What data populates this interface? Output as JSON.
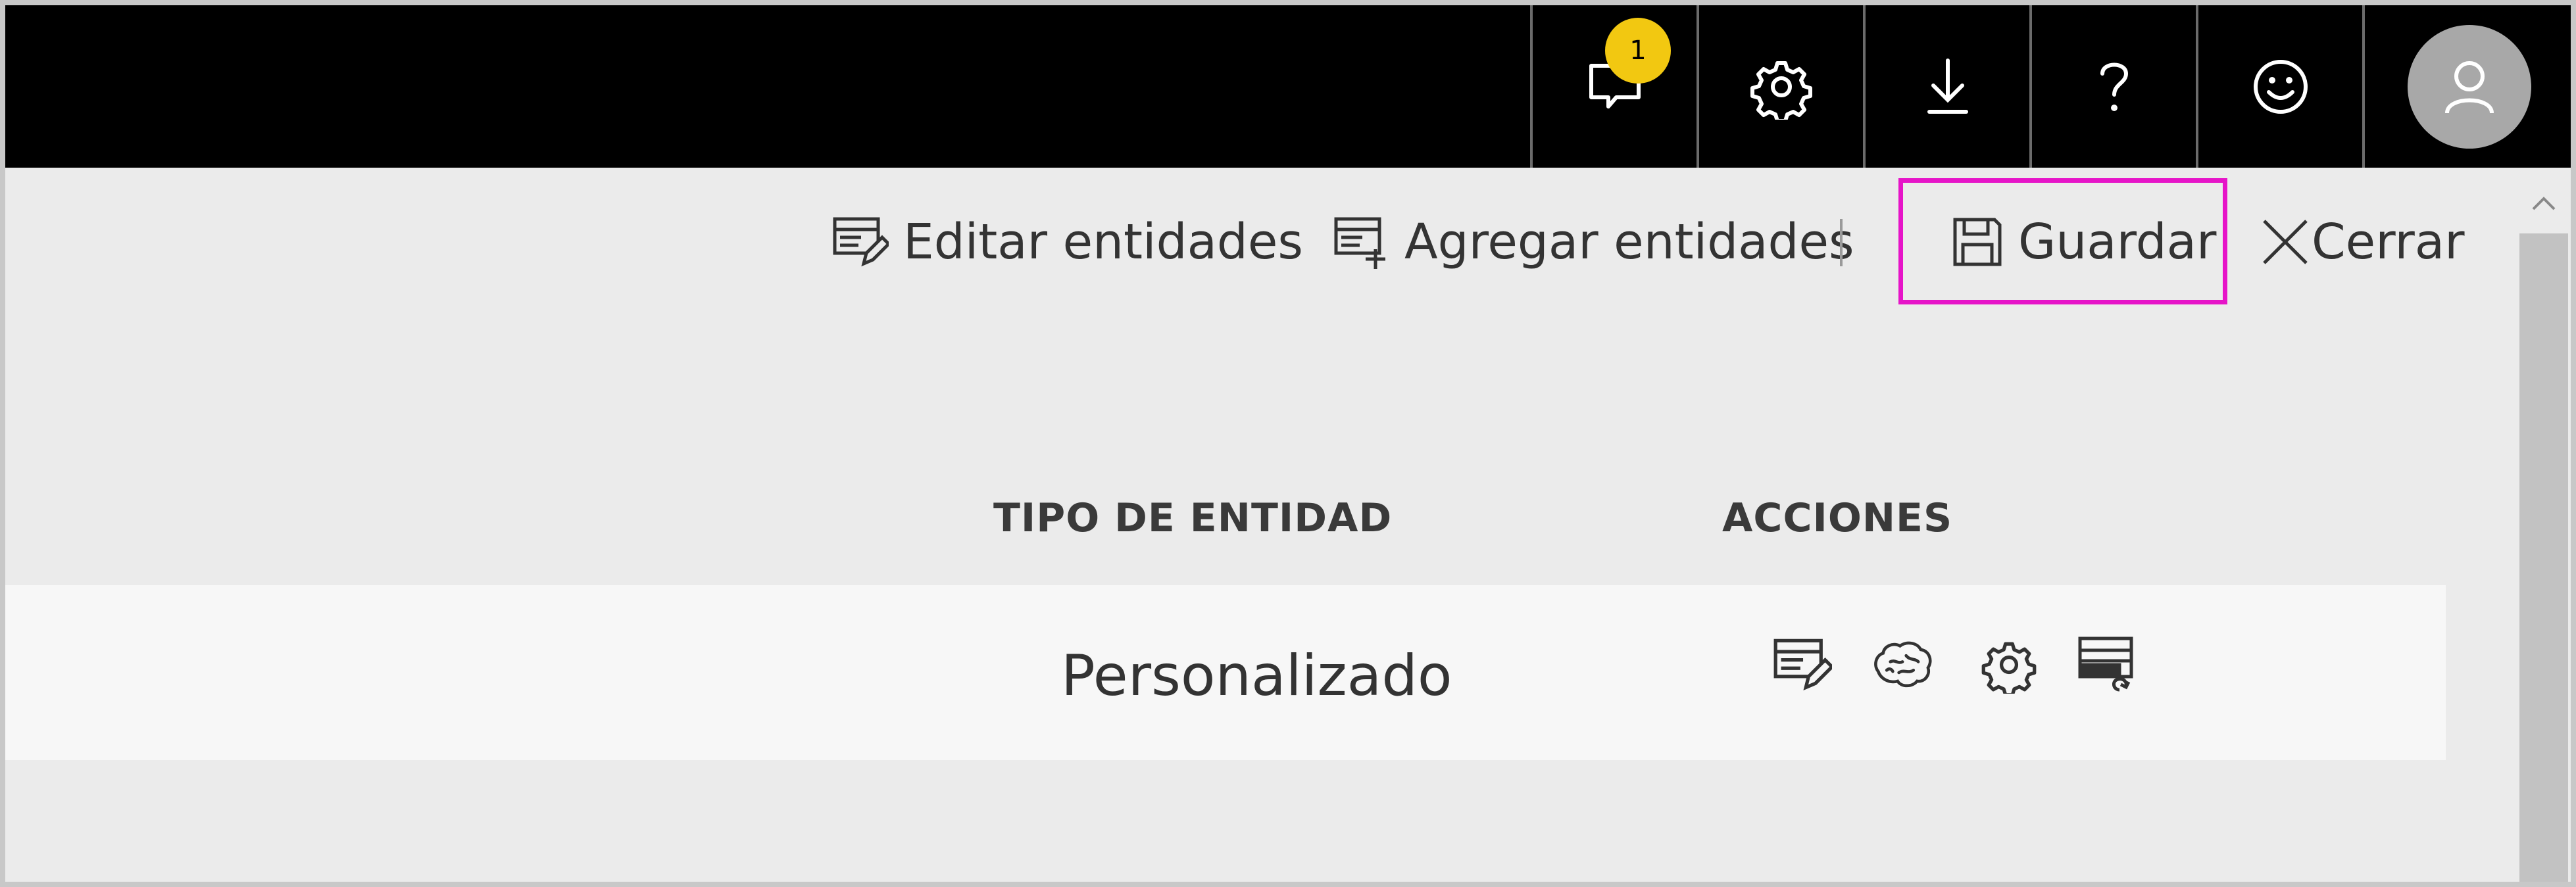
{
  "topbar": {
    "notifications": {
      "icon": "chat-bubble-icon",
      "badge_count": "1"
    },
    "settings": {
      "icon": "gear-icon"
    },
    "download": {
      "icon": "download-arrow-icon"
    },
    "help": {
      "icon": "question-mark-icon"
    },
    "feedback": {
      "icon": "smiley-icon"
    },
    "account": {
      "icon": "user-avatar-icon"
    },
    "badge_color": "#f2c811"
  },
  "toolbar": {
    "edit_entities_label": "Editar entidades",
    "add_entities_label": "Agregar entidades",
    "save_label": "Guardar",
    "close_label": "Cerrar",
    "highlight_color": "#e614c8"
  },
  "table": {
    "columns": [
      "TIPO DE ENTIDAD",
      "ACCIONES"
    ],
    "rows": [
      {
        "entity_type": "Personalizado",
        "actions": [
          "edit-entity-icon",
          "brain-icon",
          "gear-icon",
          "refresh-table-icon"
        ]
      }
    ]
  }
}
